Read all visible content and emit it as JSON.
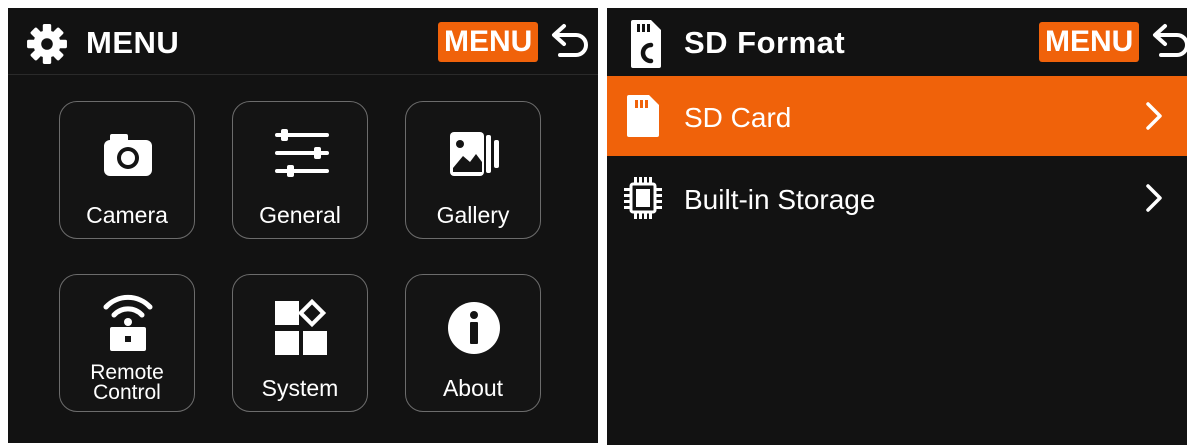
{
  "menu_screen": {
    "header": {
      "title": "MENU",
      "menu_badge": "MENU",
      "icon": "gear-icon",
      "back_icon": "back-arrow-icon"
    },
    "tiles": [
      {
        "label": "Camera",
        "icon": "camera-icon"
      },
      {
        "label": "General",
        "icon": "sliders-icon"
      },
      {
        "label": "Gallery",
        "icon": "gallery-icon"
      },
      {
        "label": "Remote\nControl",
        "icon": "remote-control-icon"
      },
      {
        "label": "System",
        "icon": "system-icon"
      },
      {
        "label": "About",
        "icon": "info-icon"
      }
    ]
  },
  "sd_format_screen": {
    "header": {
      "title": "SD Format",
      "menu_badge": "MENU",
      "icon": "sd-format-icon",
      "back_icon": "back-arrow-icon"
    },
    "items": [
      {
        "label": "SD Card",
        "icon": "sd-card-icon",
        "selected": true
      },
      {
        "label": "Built-in Storage",
        "icon": "chip-icon",
        "selected": false
      }
    ]
  },
  "colors": {
    "accent": "#f0620a",
    "background": "#121212",
    "tile_border": "#6c6c6c",
    "text": "#ffffff"
  }
}
